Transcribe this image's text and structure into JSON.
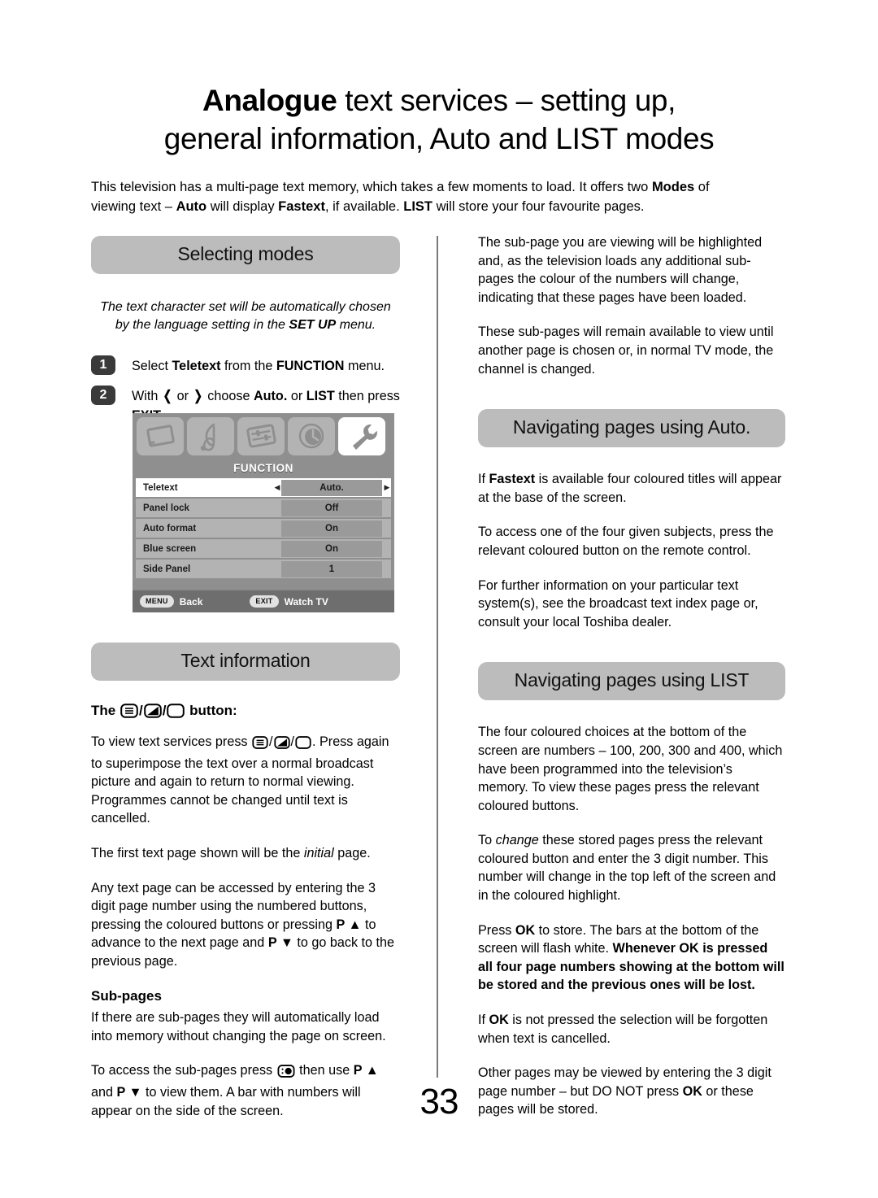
{
  "page": {
    "title_bold": "Analogue",
    "title_rest": " text services – setting up,",
    "title_line2": "general information, Auto and LIST modes",
    "number": "33"
  },
  "intro": {
    "part1": "This television has a multi-page text memory, which takes a few moments to load. It offers two ",
    "bold1": "Modes",
    "part2": " of viewing text – ",
    "bold2": "Auto",
    "part3": " will display ",
    "bold3": "Fastext",
    "part4": ", if available. ",
    "bold4": "LIST",
    "part5": " will store your four favourite pages."
  },
  "left_column": {
    "section1": {
      "heading": "Selecting modes",
      "note_part1": "The text character set will be automatically chosen by the language setting in the ",
      "note_bold": "SET UP",
      "note_part2": " menu.",
      "steps": [
        {
          "number": "1",
          "text_part1": "Select ",
          "bold1": "Teletext",
          "text_part2": " from the ",
          "bold2": "FUNCTION",
          "text_part3": " menu."
        },
        {
          "number": "2",
          "text_part1": "With ",
          "glyph_left": "❬",
          "text_or": " or ",
          "glyph_right": "❭",
          "text_part2": " choose ",
          "bold1": "Auto.",
          "text_part3": " or ",
          "bold2": "LIST",
          "text_part4": " then press ",
          "bold3": "EXIT",
          "text_part5": "."
        }
      ]
    },
    "osd": {
      "title": "FUNCTION",
      "icons": [
        "picture-icon",
        "sound-icon",
        "setup-icon",
        "timer-icon",
        "function-wrench-icon"
      ],
      "active_icon_index": 4,
      "rows": [
        {
          "label": "Teletext",
          "value": "Auto.",
          "selected": true
        },
        {
          "label": "Panel lock",
          "value": "Off",
          "selected": false
        },
        {
          "label": "Auto format",
          "value": "On",
          "selected": false
        },
        {
          "label": "Blue screen",
          "value": "On",
          "selected": false
        },
        {
          "label": "Side Panel",
          "value": "1",
          "selected": false
        }
      ],
      "footer": {
        "menu_key": "MENU",
        "menu_label": "Back",
        "exit_key": "EXIT",
        "exit_label": "Watch TV"
      }
    },
    "section2": {
      "heading": "Text information",
      "button_heading_pre": "The ",
      "button_heading_post": " button:",
      "para1_pre": "To view text services press ",
      "para1_post": ". Press again to superimpose the text over a normal broadcast picture and again to return to normal viewing. Programmes cannot be changed until text is cancelled.",
      "para2_pre": "The first text page shown will be the ",
      "para2_italic": "initial",
      "para2_post": " page.",
      "para3_pre": "Any text page can be accessed by entering the 3 digit page number using the numbered buttons, pressing the coloured buttons or pressing ",
      "para3_p_up": "P ▲",
      "para3_mid": " to advance to the next page and ",
      "para3_p_down": "P ▼",
      "para3_post": " to go back to the previous page.",
      "subpages_heading": "Sub-pages",
      "para4": "If there are sub-pages they will automatically load into memory without changing the page on screen.",
      "para5_pre": "To access the sub-pages press ",
      "para5_mid": " then use ",
      "para5_p_up": "P ▲",
      "para5_and": " and  ",
      "para5_p_down": "P ▼",
      "para5_post": " to view them. A bar with numbers will appear on the side of the screen."
    }
  },
  "right_column": {
    "para1": "The sub-page you are viewing will be highlighted and, as the television loads any additional sub-pages the colour of the numbers will change, indicating that these pages have been loaded.",
    "para2": "These sub-pages will remain available to view until another page is chosen or, in normal TV mode, the channel is changed.",
    "section_auto": {
      "heading": "Navigating pages using Auto.",
      "para1_pre": "If ",
      "para1_bold": "Fastext",
      "para1_post": " is available four coloured titles will appear at the base of the screen.",
      "para2": "To access one of the four given subjects, press the relevant coloured button on the remote control.",
      "para3": "For further information on your particular text system(s), see the broadcast text index page or, consult your local Toshiba dealer."
    },
    "section_list": {
      "heading": "Navigating pages using LIST",
      "para1": "The four coloured choices at the bottom of the screen are numbers – 100, 200, 300 and 400, which have been programmed into the television’s memory. To view these pages press the relevant coloured buttons.",
      "para2_pre": "To ",
      "para2_italic": "change",
      "para2_post": " these stored pages press the relevant coloured button and enter the 3 digit number. This number will change in the top left of the screen and in the coloured highlight.",
      "para3_pre": "Press ",
      "para3_bold1": "OK",
      "para3_mid": " to store. The bars at the bottom of the screen will flash white. ",
      "para3_bold2": "Whenever OK is pressed all four page numbers showing at the bottom will be stored and the previous ones will be lost.",
      "para4_pre": "If ",
      "para4_bold": "OK",
      "para4_post": " is not pressed the selection will be forgotten when text is cancelled.",
      "para5_pre": "Other pages may be viewed by entering the 3 digit page number – but DO NOT press ",
      "para5_bold": "OK",
      "para5_post": " or these pages will be stored."
    }
  },
  "colors": {
    "pill_background": "#bcbcbc",
    "badge_background": "#3a3a3a",
    "osd_background": "#8f8f8f",
    "osd_row": "#b3b3b3",
    "osd_value": "#9a9a9a",
    "divider": "#7a7a7a"
  }
}
